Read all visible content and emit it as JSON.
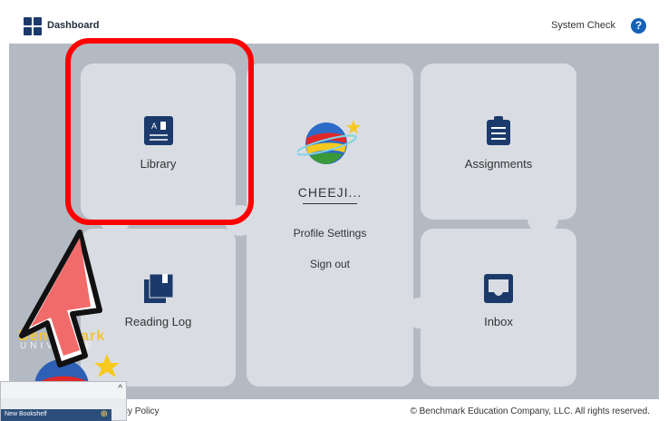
{
  "header": {
    "title": "Dashboard",
    "system_check": "System Check",
    "help": "?"
  },
  "tiles": {
    "library": "Library",
    "assignments": "Assignments",
    "reading_log": "Reading Log",
    "inbox": "Inbox"
  },
  "profile": {
    "username": "CHEEJI...",
    "settings": "Profile Settings",
    "sign_out": "Sign out"
  },
  "footer": {
    "privacy": "cy Policy",
    "copyright": "© Benchmark Education Company, LLC. All rights reserved."
  },
  "overlay": {
    "brand_text": "Benchmark",
    "brand_sub": "UNIVERSE",
    "panel_item": "New Bookshelf",
    "panel_plus": "⊕",
    "panel_caret": "^"
  },
  "colors": {
    "accent": "#1661b8",
    "highlight": "#ff0000",
    "tile": "#d9dde3",
    "background": "#b4bac3"
  },
  "icons": {
    "library": "book-icon",
    "assignments": "clipboard-icon",
    "reading_log": "reading-log-icon",
    "inbox": "inbox-icon",
    "avatar": "planet-avatar-icon"
  }
}
